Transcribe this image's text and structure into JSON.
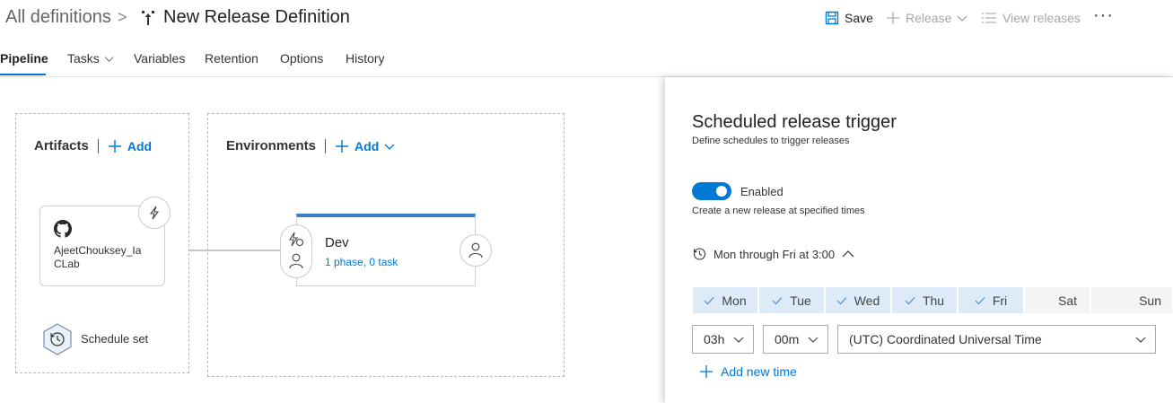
{
  "header": {
    "breadcrumb_root": "All definitions",
    "breadcrumb_separator": ">",
    "title": "New Release Definition",
    "save_label": "Save",
    "release_label": "Release",
    "view_releases_label": "View releases",
    "more_label": "···"
  },
  "tabs": [
    {
      "label": "Pipeline",
      "active": true
    },
    {
      "label": "Tasks",
      "has_dropdown": true
    },
    {
      "label": "Variables"
    },
    {
      "label": "Retention"
    },
    {
      "label": "Options"
    },
    {
      "label": "History"
    }
  ],
  "pipeline": {
    "artifacts_title": "Artifacts",
    "artifacts_add": "Add",
    "artifact_name": "AjeetChouksey_IaCLab",
    "artifact_name_line1": "AjeetChouksey_Ia",
    "artifact_name_line2": "CLab",
    "schedule_label": "Schedule set",
    "environments_title": "Environments",
    "environments_add": "Add",
    "environment": {
      "name": "Dev",
      "detail": "1 phase, 0 task"
    }
  },
  "panel": {
    "title": "Scheduled release trigger",
    "subtitle": "Define schedules to trigger releases",
    "toggle_label": "Enabled",
    "toggle_on": true,
    "toggle_description": "Create a new release at specified times",
    "schedule_summary": "Mon through Fri at 3:00",
    "days": [
      {
        "label": "Mon",
        "selected": true
      },
      {
        "label": "Tue",
        "selected": true
      },
      {
        "label": "Wed",
        "selected": true
      },
      {
        "label": "Thu",
        "selected": true
      },
      {
        "label": "Fri",
        "selected": true
      },
      {
        "label": "Sat",
        "selected": false
      },
      {
        "label": "Sun",
        "selected": false
      }
    ],
    "hour_value": "03h",
    "minute_value": "00m",
    "timezone_value": "(UTC) Coordinated Universal Time",
    "add_time_label": "Add new time"
  },
  "colors": {
    "accent": "#0078d4",
    "selected_day_bg": "#dcebf7",
    "environment_bar": "#3b7fc4"
  },
  "icons": [
    "save-icon",
    "plus-icon",
    "chevron-down-icon",
    "list-icon",
    "github-icon",
    "lightning-icon",
    "history-icon",
    "person-icon",
    "check-icon",
    "chevron-up-icon"
  ]
}
